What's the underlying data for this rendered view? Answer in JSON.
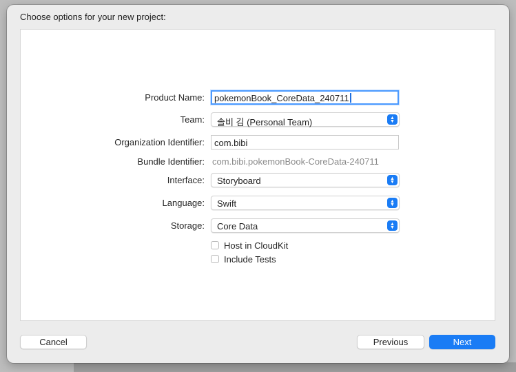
{
  "dialog": {
    "title": "Choose options for your new project:"
  },
  "form": {
    "product_name": {
      "label": "Product Name:",
      "value": "pokemonBook_CoreData_240711"
    },
    "team": {
      "label": "Team:",
      "value": "솔비 김 (Personal Team)"
    },
    "organization_identifier": {
      "label": "Organization Identifier:",
      "value": "com.bibi"
    },
    "bundle_identifier": {
      "label": "Bundle Identifier:",
      "value": "com.bibi.pokemonBook-CoreData-240711"
    },
    "interface": {
      "label": "Interface:",
      "value": "Storyboard"
    },
    "language": {
      "label": "Language:",
      "value": "Swift"
    },
    "storage": {
      "label": "Storage:",
      "value": "Core Data"
    },
    "host_in_cloudkit": {
      "label": "Host in CloudKit",
      "checked": false
    },
    "include_tests": {
      "label": "Include Tests",
      "checked": false
    }
  },
  "buttons": {
    "cancel": "Cancel",
    "previous": "Previous",
    "next": "Next"
  },
  "colors": {
    "accent": "#1a7cf5",
    "focus_ring": "#4c9aff",
    "sheet_background": "#ececec"
  },
  "icons": {
    "popup_arrows": "up-down-chevron-icon"
  }
}
